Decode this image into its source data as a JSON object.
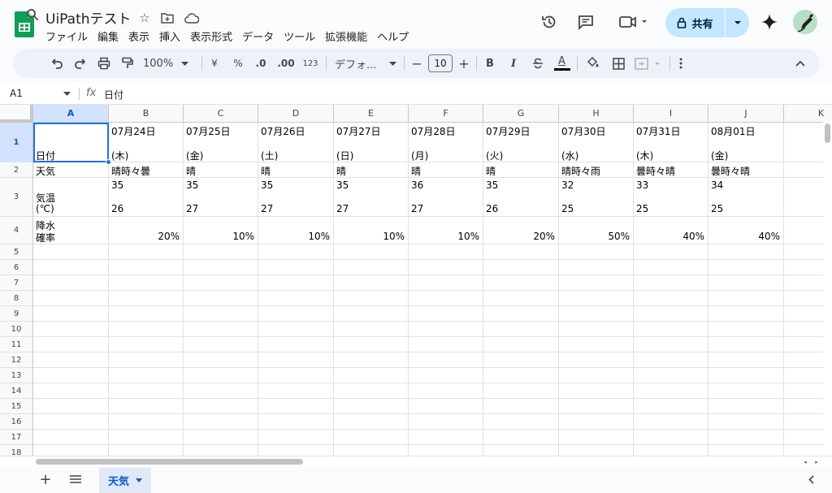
{
  "app": {
    "title": "UiPathテスト",
    "menu": [
      "ファイル",
      "編集",
      "表示",
      "挿入",
      "表示形式",
      "データ",
      "ツール",
      "拡張機能",
      "ヘルプ"
    ],
    "share_label": "共有"
  },
  "toolbar": {
    "zoom": "100%",
    "currency": "¥",
    "percent": "%",
    "decimal_decrease": ".0",
    "decimal_increase": ".00",
    "format_number": "123",
    "font": "デフォ...",
    "font_size": "10",
    "bold": "B",
    "italic": "I",
    "text_color": "A"
  },
  "formula_bar": {
    "cell_ref": "A1",
    "fx": "fx",
    "value": "日付"
  },
  "columns": [
    "A",
    "B",
    "C",
    "D",
    "E",
    "F",
    "G",
    "H",
    "I",
    "J",
    "K"
  ],
  "rows": [
    "1",
    "2",
    "3",
    "4",
    "5",
    "6",
    "7",
    "8",
    "9",
    "10",
    "11",
    "12",
    "13",
    "14",
    "15",
    "16",
    "17",
    "18"
  ],
  "sheet": {
    "row1": {
      "label": "日付",
      "dates": [
        "07月24日",
        "07月25日",
        "07月26日",
        "07月27日",
        "07月28日",
        "07月29日",
        "07月30日",
        "07月31日",
        "08月01日"
      ],
      "weekdays": [
        "(木)",
        "(金)",
        "(土)",
        "(日)",
        "(月)",
        "(火)",
        "(水)",
        "(木)",
        "(金)"
      ]
    },
    "row2": {
      "label": "天気",
      "values": [
        "晴時々曇",
        "晴",
        "晴",
        "晴",
        "晴",
        "晴",
        "晴時々雨",
        "曇時々晴",
        "曇時々晴"
      ]
    },
    "row3": {
      "label_line1": "気温",
      "label_line2": "(℃)",
      "high": [
        "35",
        "35",
        "35",
        "35",
        "36",
        "35",
        "32",
        "33",
        "34"
      ],
      "low": [
        "26",
        "27",
        "27",
        "27",
        "27",
        "26",
        "25",
        "25",
        "25"
      ]
    },
    "row4": {
      "label_line1": "降水",
      "label_line2": "確率",
      "values": [
        "20%",
        "10%",
        "10%",
        "10%",
        "10%",
        "20%",
        "50%",
        "40%",
        "40%"
      ]
    }
  },
  "sheet_tabs": {
    "active": "天気"
  },
  "colors": {
    "accent": "#1a73e8",
    "share_bg": "#c2e7ff",
    "selected_header": "#d3e3fd",
    "logo_green": "#0f9d58"
  }
}
